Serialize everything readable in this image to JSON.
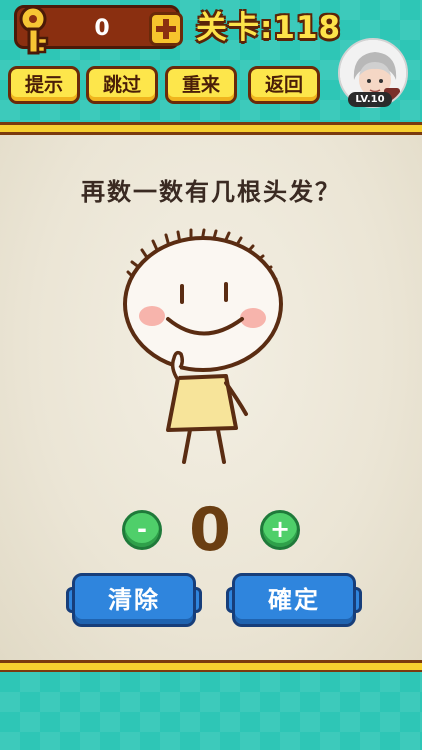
{
  "header": {
    "key_count": "0",
    "level_label": "关卡:118",
    "avatar_level": "LV.10",
    "menu": {
      "hint": "提示",
      "skip": "跳过",
      "restart": "重来",
      "back": "返回"
    }
  },
  "puzzle": {
    "question": "再数一数有几根头发？",
    "counter_value": "0",
    "minus_label": "-",
    "plus_label": "+"
  },
  "actions": {
    "clear_label": "清除",
    "confirm_label": "確定"
  },
  "icons": {
    "key": "key-icon",
    "add": "plus-icon",
    "avatar": "player-avatar"
  },
  "colors": {
    "teal_background": "#2ec6b6",
    "gold_border": "#f7d02f",
    "yellow_button": "#fde64b",
    "blue_button": "#2f85dd",
    "green_button": "#4fcf6a",
    "level_text": "#fde34a"
  }
}
